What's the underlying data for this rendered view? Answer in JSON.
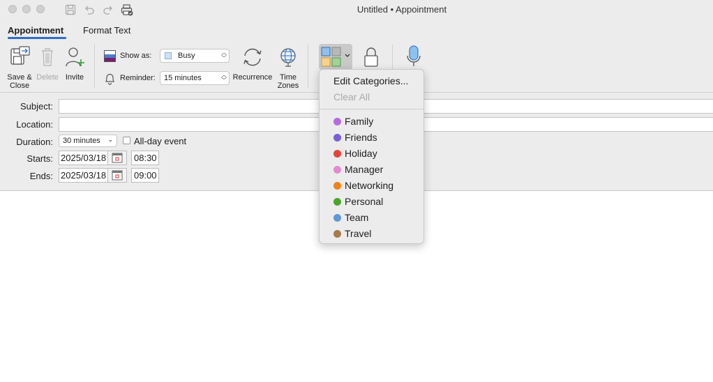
{
  "window": {
    "title": "Untitled • Appointment"
  },
  "tabs": [
    {
      "label": "Appointment",
      "active": true
    },
    {
      "label": "Format Text",
      "active": false
    }
  ],
  "ribbon": {
    "save_close": {
      "line1": "Save &",
      "line2": "Close"
    },
    "delete_label": "Delete",
    "invite_label": "Invite",
    "show_as": {
      "label": "Show as:",
      "value": "Busy"
    },
    "reminder": {
      "label": "Reminder:",
      "value": "15 minutes"
    },
    "recurrence_label": "Recurrence",
    "time_zones": {
      "line1": "Time",
      "line2": "Zones"
    }
  },
  "form": {
    "subject": {
      "label": "Subject:",
      "value": ""
    },
    "location": {
      "label": "Location:",
      "value": ""
    },
    "duration": {
      "label": "Duration:",
      "value": "30 minutes"
    },
    "all_day": {
      "label": "All-day event",
      "checked": false
    },
    "starts": {
      "label": "Starts:",
      "date": "2025/03/18",
      "time": "08:30"
    },
    "ends": {
      "label": "Ends:",
      "date": "2025/03/18",
      "time": "09:00"
    }
  },
  "categories_menu": {
    "edit_label": "Edit Categories...",
    "clear_label": "Clear All",
    "items": [
      {
        "name": "Family",
        "color": "#b56be0"
      },
      {
        "name": "Friends",
        "color": "#7a5fdc"
      },
      {
        "name": "Holiday",
        "color": "#e5443b"
      },
      {
        "name": "Manager",
        "color": "#e48ad0"
      },
      {
        "name": "Networking",
        "color": "#f0821e"
      },
      {
        "name": "Personal",
        "color": "#4ba52a"
      },
      {
        "name": "Team",
        "color": "#5f97d8"
      },
      {
        "name": "Travel",
        "color": "#a8794a"
      }
    ]
  }
}
